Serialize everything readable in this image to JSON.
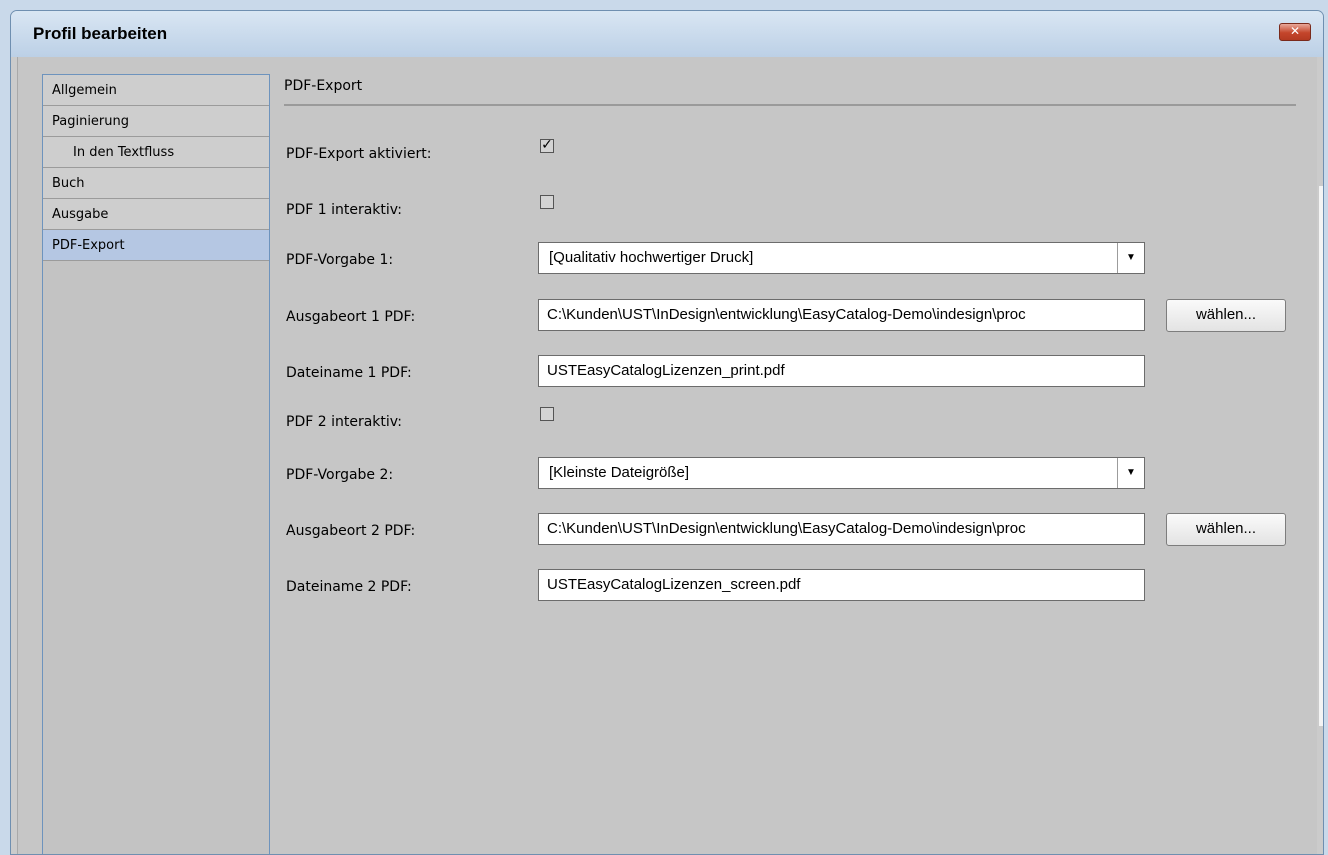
{
  "window": {
    "title": "Profil bearbeiten",
    "close_glyph": "✕",
    "close_icon": "close-icon"
  },
  "sidebar": {
    "items": [
      {
        "label": "Allgemein",
        "indent": false,
        "selected": false
      },
      {
        "label": "Paginierung",
        "indent": false,
        "selected": false
      },
      {
        "label": "In den Textfluss",
        "indent": true,
        "selected": false
      },
      {
        "label": "Buch",
        "indent": false,
        "selected": false
      },
      {
        "label": "Ausgabe",
        "indent": false,
        "selected": false
      },
      {
        "label": "PDF-Export",
        "indent": false,
        "selected": true
      }
    ]
  },
  "main": {
    "section_title": "PDF-Export",
    "export_enabled": {
      "label": "PDF-Export aktiviert:",
      "checked": true,
      "check_glyph": "✓"
    },
    "pdf1_interactive": {
      "label": "PDF 1 interaktiv:",
      "checked": false
    },
    "pdf_preset_1": {
      "label": "PDF-Vorgabe 1:",
      "value": "[Qualitativ hochwertiger Druck]"
    },
    "output_1": {
      "label": "Ausgabeort 1 PDF:",
      "value": "C:\\Kunden\\UST\\InDesign\\entwicklung\\EasyCatalog-Demo\\indesign\\proc",
      "button": "wählen..."
    },
    "filename_1": {
      "label": "Dateiname 1 PDF:",
      "value": "USTEasyCatalogLizenzen_print.pdf"
    },
    "pdf2_interactive": {
      "label": "PDF 2 interaktiv:",
      "checked": false
    },
    "pdf_preset_2": {
      "label": "PDF-Vorgabe 2:",
      "value": "[Kleinste Dateigröße]"
    },
    "output_2": {
      "label": "Ausgabeort 2 PDF:",
      "value": "C:\\Kunden\\UST\\InDesign\\entwicklung\\EasyCatalog-Demo\\indesign\\proc",
      "button": "wählen..."
    },
    "filename_2": {
      "label": "Dateiname 2 PDF:",
      "value": "USTEasyCatalogLizenzen_screen.pdf"
    }
  },
  "icons": {
    "dropdown_arrow": "▼"
  },
  "colors": {
    "selected_item": "#b5c7e3",
    "close_button": "#c4452b",
    "frame_border": "#6f8fb0"
  }
}
